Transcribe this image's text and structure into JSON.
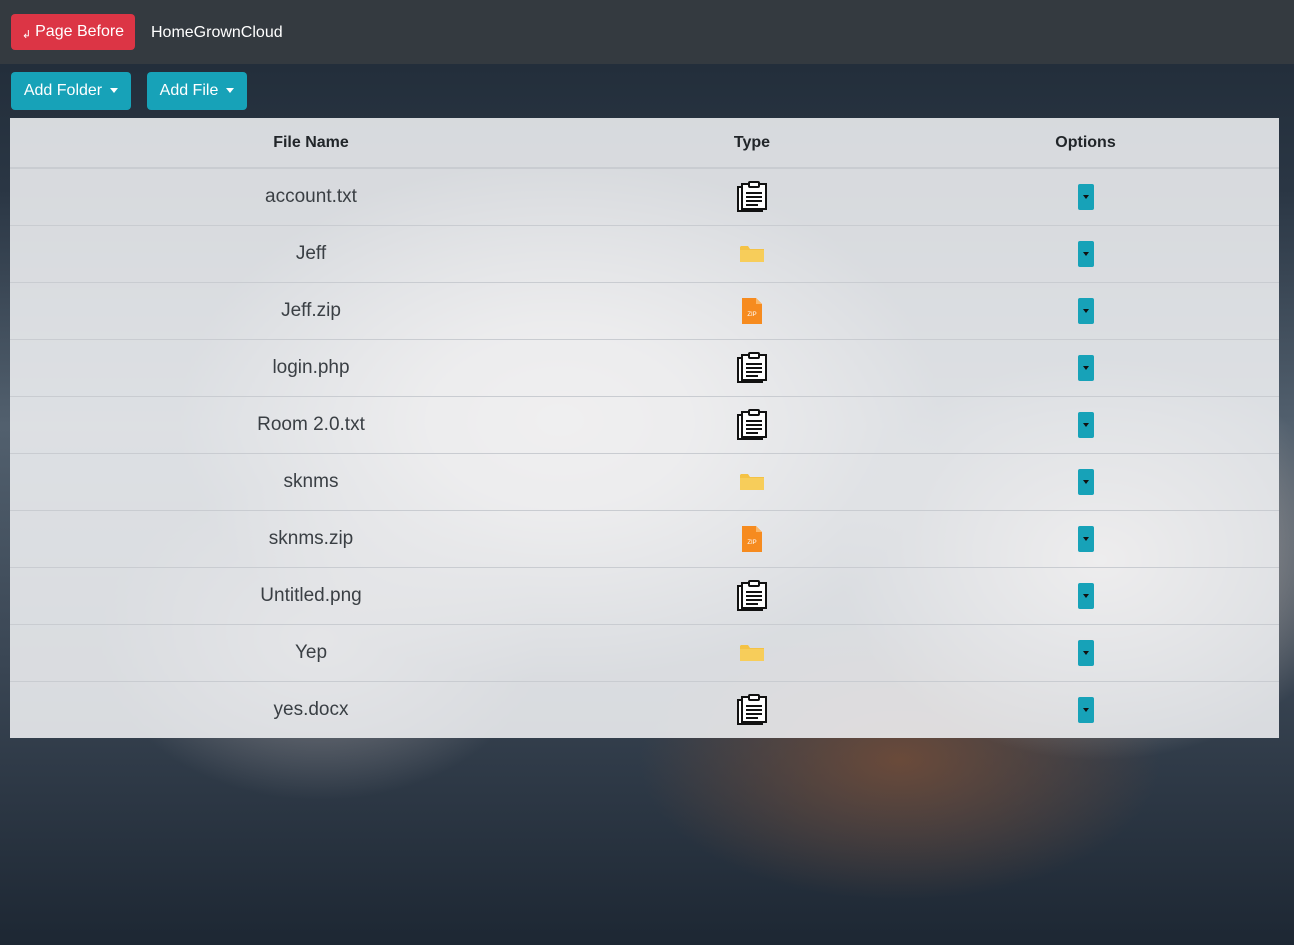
{
  "navbar": {
    "back_label": "Page Before",
    "brand": "HomeGrownCloud"
  },
  "actions": {
    "add_folder": "Add Folder",
    "add_file": "Add File"
  },
  "table": {
    "headers": [
      "File Name",
      "Type",
      "Options"
    ],
    "rows": [
      {
        "name": "account.txt",
        "type": "document"
      },
      {
        "name": "Jeff",
        "type": "folder"
      },
      {
        "name": "Jeff.zip",
        "type": "zip"
      },
      {
        "name": "login.php",
        "type": "document"
      },
      {
        "name": "Room 2.0.txt",
        "type": "document"
      },
      {
        "name": "sknms",
        "type": "folder"
      },
      {
        "name": "sknms.zip",
        "type": "zip"
      },
      {
        "name": "Untitled.png",
        "type": "document"
      },
      {
        "name": "Yep",
        "type": "folder"
      },
      {
        "name": "yes.docx",
        "type": "document"
      }
    ]
  },
  "icons": {
    "document": "clipboard-document-icon",
    "folder": "folder-icon",
    "zip": "zip-file-icon",
    "zip_label": "ZIP"
  },
  "colors": {
    "navbar": "#343a40",
    "danger": "#dc3545",
    "info": "#17a2b8",
    "folder": "#f4c245",
    "zip": "#f68b1f"
  }
}
